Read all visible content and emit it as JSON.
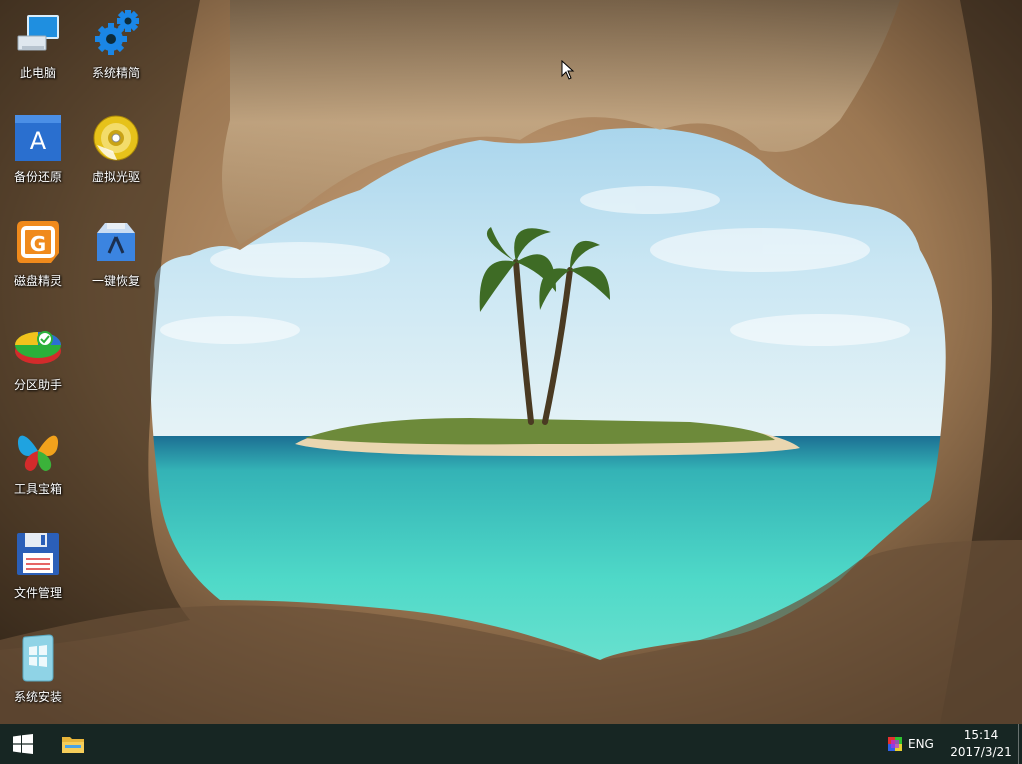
{
  "desktop": {
    "icons": [
      {
        "label": "此电脑",
        "icon": "computer-icon"
      },
      {
        "label": "系统精简",
        "icon": "gears-icon"
      },
      {
        "label": "备份还原",
        "icon": "backup-restore-icon"
      },
      {
        "label": "虚拟光驱",
        "icon": "virtual-cd-drive-icon"
      },
      {
        "label": "磁盘精灵",
        "icon": "disk-genius-icon"
      },
      {
        "label": "一键恢复",
        "icon": "one-key-recovery-icon"
      },
      {
        "label": "分区助手",
        "icon": "partition-assistant-icon"
      },
      {
        "label": "工具宝箱",
        "icon": "toolbox-icon"
      },
      {
        "label": "文件管理",
        "icon": "floppy-disk-icon"
      },
      {
        "label": "系统安装",
        "icon": "system-install-icon"
      }
    ]
  },
  "taskbar": {
    "start": "windows-logo-icon",
    "pinned": [
      "file-explorer-icon"
    ],
    "tray": {
      "language": "ENG",
      "time": "15:14",
      "date": "2017/3/21"
    }
  },
  "colors": {
    "taskbar": "#142624",
    "accent": "#2b7bd9"
  }
}
